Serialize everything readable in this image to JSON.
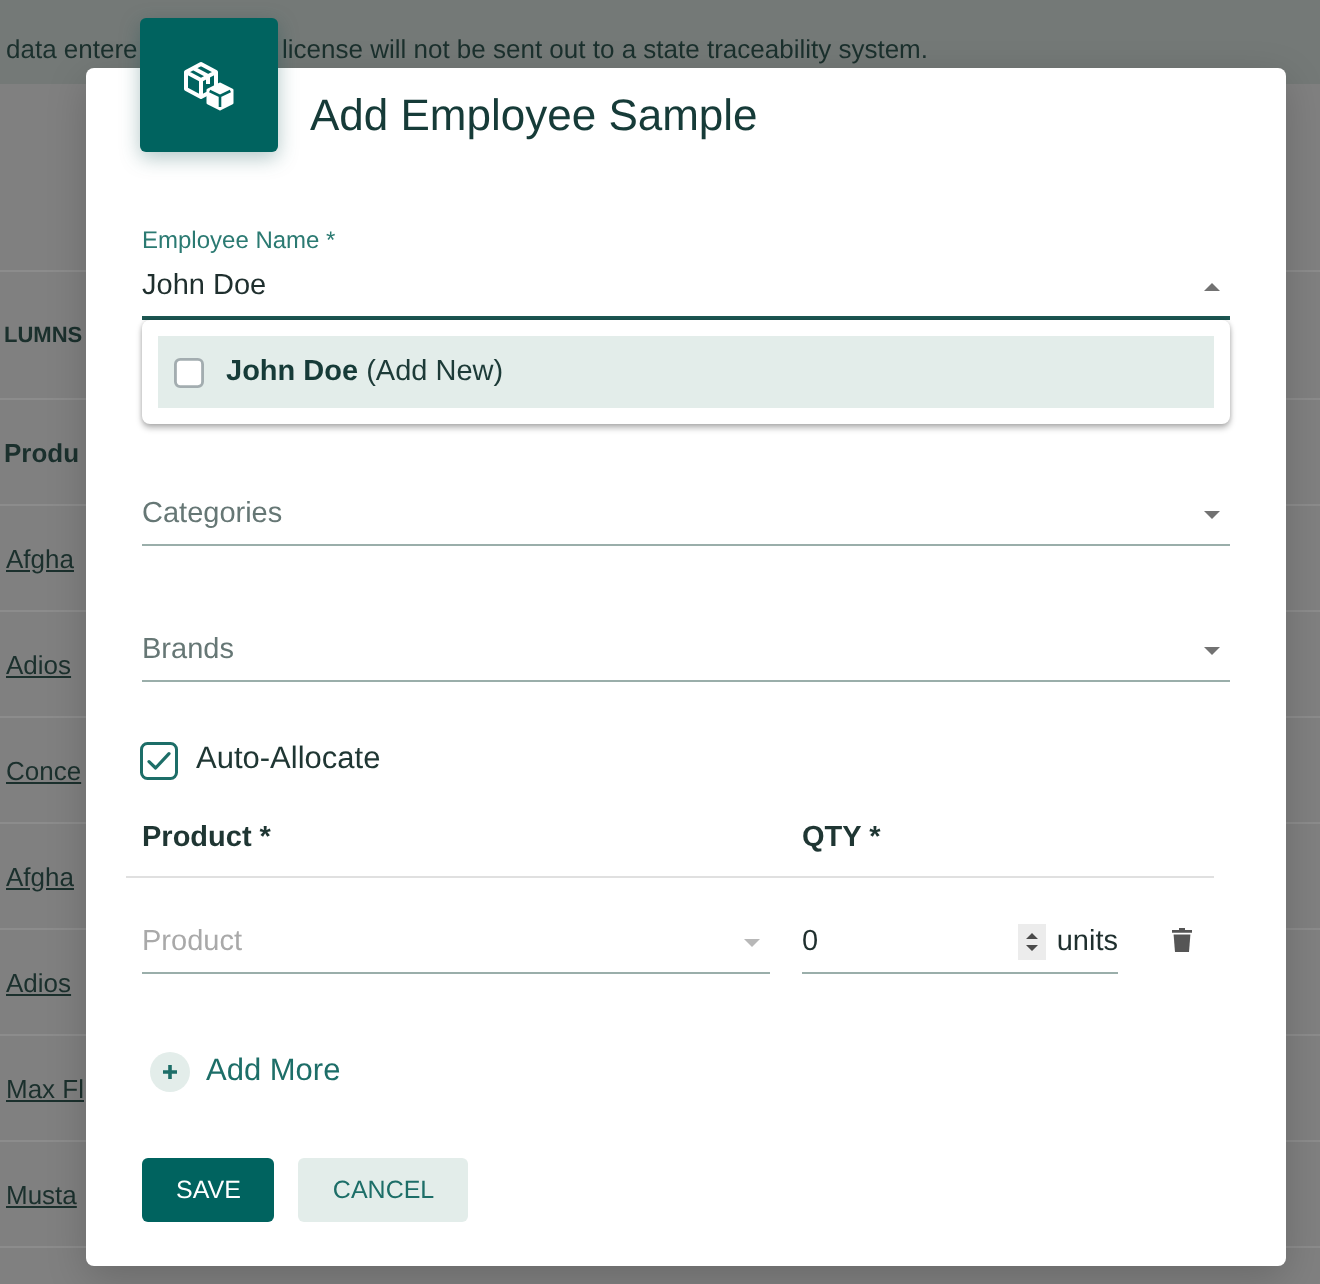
{
  "background_page": {
    "notice": [
      "data entere",
      "license will not be sent out to a state traceability system."
    ],
    "toolbar_label": "LUMNS",
    "column_header": "Produ",
    "rows": [
      "Afgha",
      "Adios",
      "Conce",
      "Afgha",
      "Adios",
      "Max Fl",
      "Musta"
    ]
  },
  "dialog": {
    "title": "Add Employee Sample",
    "fields": [
      {
        "kind": "select",
        "label": "Employee Name *",
        "value": "John Doe",
        "expanded": true,
        "options": [
          {
            "label": "**John Doe** (Add New)",
            "checked": false,
            "highlighted": true
          }
        ]
      },
      {
        "kind": "select",
        "label": "Categories",
        "expanded": false
      },
      {
        "kind": "select",
        "label": "Brands",
        "expanded": false
      }
    ],
    "auto_allocate": {
      "label": "Auto-Allocate",
      "checked": true
    },
    "table": {
      "columns": [
        "Product *",
        "QTY *"
      ],
      "rows": [
        {
          "product": {
            "kind": "select",
            "placeholder": "Product"
          },
          "qty": {
            "value": "0",
            "unit": "units"
          }
        }
      ]
    },
    "add_more": "Add More",
    "buttons": [
      {
        "label": "SAVE",
        "kind": "primary"
      },
      {
        "label": "CANCEL",
        "kind": "secondary"
      }
    ]
  }
}
